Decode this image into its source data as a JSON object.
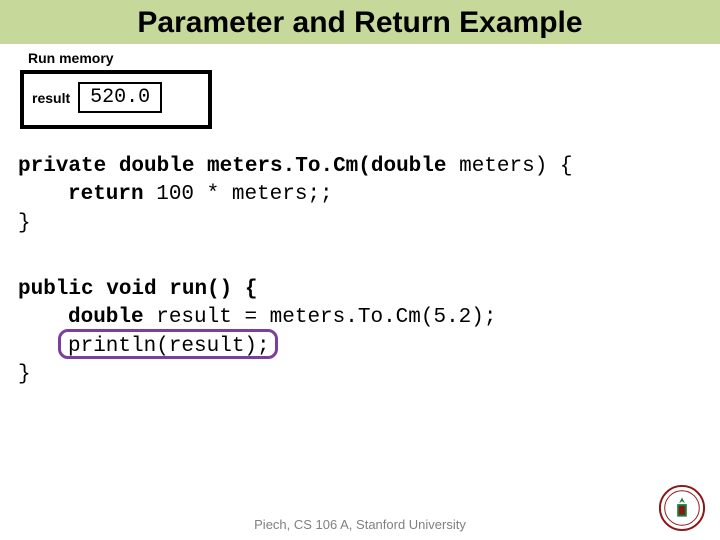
{
  "title": "Parameter and Return Example",
  "memory": {
    "heading": "Run memory",
    "var_name": "result",
    "var_value": "520.0"
  },
  "code1": {
    "sig_a": "private double",
    "sig_b": "meters.To.Cm(",
    "sig_c": "double",
    "sig_d": " meters) {",
    "ret_a": "return",
    "ret_b": " 100 * meters;;",
    "close": "}"
  },
  "code2": {
    "sig_a": "public void",
    "sig_b": "run() {",
    "line1_a": "double",
    "line1_b": " result = meters.To.Cm(5.2);",
    "line2": "println(result);",
    "close": "}"
  },
  "footer": "Piech, CS 106 A, Stanford University"
}
